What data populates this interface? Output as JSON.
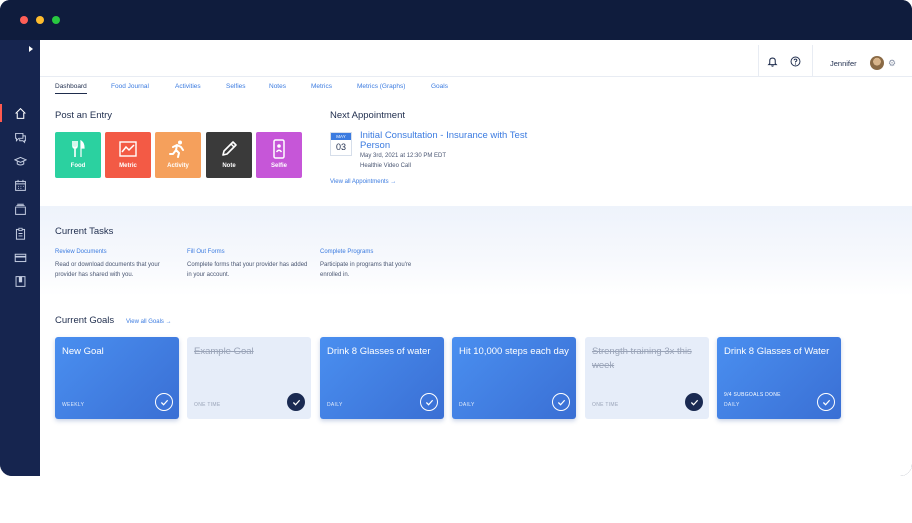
{
  "window": {
    "controls": [
      "close",
      "minimize",
      "maximize"
    ],
    "colors": {
      "close": "#ff5f57",
      "minimize": "#febc2e",
      "maximize": "#28c840"
    }
  },
  "sidebar": {
    "items": [
      {
        "icon": "home-icon",
        "active": true
      },
      {
        "icon": "chat-icon"
      },
      {
        "icon": "graduation-cap-icon"
      },
      {
        "icon": "calendar-icon"
      },
      {
        "icon": "folder-icon"
      },
      {
        "icon": "clipboard-icon"
      },
      {
        "icon": "credit-card-icon"
      },
      {
        "icon": "book-icon"
      }
    ]
  },
  "topbar": {
    "user_name": "Jennifer",
    "icons": [
      "bell-icon",
      "help-icon",
      "gear-icon"
    ]
  },
  "tabs": [
    {
      "label": "Dashboard",
      "active": true
    },
    {
      "label": "Food Journal"
    },
    {
      "label": "Activities"
    },
    {
      "label": "Selfies"
    },
    {
      "label": "Notes"
    },
    {
      "label": "Metrics"
    },
    {
      "label": "Metrics (Graphs)"
    },
    {
      "label": "Goals"
    }
  ],
  "post_entry": {
    "title": "Post an Entry",
    "buttons": [
      {
        "label": "Food",
        "color": "#2bd1a0",
        "icon": "fork-knife-icon"
      },
      {
        "label": "Metric",
        "color": "#f35a45",
        "icon": "chart-line-icon"
      },
      {
        "label": "Activity",
        "color": "#f5a05c",
        "icon": "running-icon"
      },
      {
        "label": "Note",
        "color": "#3a3a3a",
        "icon": "pencil-icon"
      },
      {
        "label": "Selfie",
        "color": "#c656d8",
        "icon": "selfie-icon"
      }
    ]
  },
  "next_appointment": {
    "title": "Next Appointment",
    "month": "MAY",
    "day": "03",
    "name": "Initial Consultation - Insurance with Test Person",
    "datetime": "May 3rd, 2021 at 12:30 PM EDT",
    "type": "Healthie Video Call",
    "view_all": "View all Appointments →"
  },
  "current_tasks": {
    "title": "Current Tasks",
    "items": [
      {
        "title": "Review Documents",
        "desc": "Read or download documents that your provider has shared with you."
      },
      {
        "title": "Fill Out Forms",
        "desc": "Complete forms that your provider has added in your account."
      },
      {
        "title": "Complete Programs",
        "desc": "Participate in programs that you're enrolled in."
      }
    ]
  },
  "current_goals": {
    "title": "Current Goals",
    "view_all": "View all Goals →",
    "cards": [
      {
        "title": "New Goal",
        "frequency": "WEEKLY",
        "completed": false,
        "subgoals": ""
      },
      {
        "title": "Example Goal",
        "frequency": "ONE TIME",
        "completed": true,
        "subgoals": ""
      },
      {
        "title": "Drink 8 Glasses of water",
        "frequency": "DAILY",
        "completed": false,
        "subgoals": ""
      },
      {
        "title": "Hit 10,000 steps each day",
        "frequency": "DAILY",
        "completed": false,
        "subgoals": ""
      },
      {
        "title": "Strength training 3x this week",
        "frequency": "ONE TIME",
        "completed": true,
        "subgoals": ""
      },
      {
        "title": "Drink 8 Glasses of Water",
        "frequency": "DAILY",
        "completed": false,
        "subgoals": "9/4 SUBGOALS DONE"
      }
    ]
  }
}
